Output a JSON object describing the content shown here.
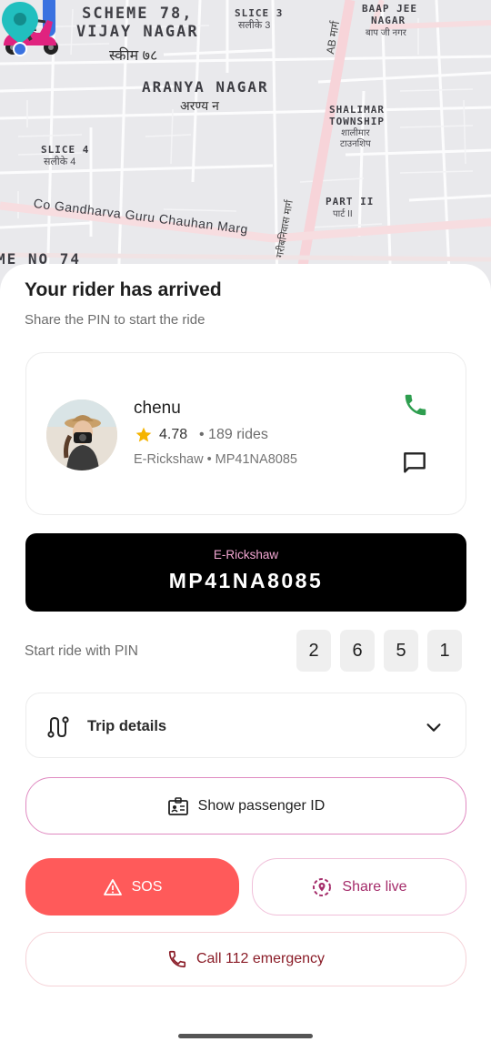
{
  "map": {
    "labels": {
      "scheme78": "SCHEME 78,\nVIJAY NAGAR",
      "scheme78_hi": "स्कीम ७८",
      "slice3": "SLICE 3",
      "slice3_hi": "सलीके 3",
      "baap_jee": "BAAP JEE",
      "baap_jee2": "NAGAR",
      "baap_jee_hi": "बाप जी नगर",
      "aranya": "ARANYA NAGAR",
      "aranya_hi": "अरण्य न",
      "shalimar": "SHALIMAR\nTOWNSHIP",
      "shalimar_hi": "शालीमार\nटाउनशिप",
      "slice4": "SLICE 4",
      "slice4_hi": "सलीके 4",
      "part2": "PART II",
      "part2_hi": "पार्ट II",
      "road": "Co Gandharva Guru Chauhan Marg",
      "ab_road": "AB मार्ग",
      "gari_road": "गरीबनिवास मार्ग",
      "scheme_bottom": "ME NO 74"
    }
  },
  "sheet": {
    "title": "Your rider has arrived",
    "subtitle": "Share the PIN to start the ride"
  },
  "driver": {
    "name": "chenu",
    "rating": "4.78",
    "rides": "• 189 rides",
    "vehicle_line": "E-Rickshaw • MP41NA8085"
  },
  "plate": {
    "type": "E-Rickshaw",
    "number": "MP41NA8085"
  },
  "pin": {
    "label": "Start ride with PIN",
    "digits": [
      "2",
      "6",
      "5",
      "1"
    ]
  },
  "trip": {
    "label": "Trip details"
  },
  "buttons": {
    "show_id": "Show passenger ID",
    "sos": "SOS",
    "share_live": "Share live",
    "call_emergency": "Call 112 emergency"
  },
  "colors": {
    "sos_bg": "#ff5a5a",
    "share_text": "#a52d6b",
    "call_text": "#8a1c27",
    "phone_green": "#2e9e4f",
    "star": "#f5b400",
    "plate_type": "#f2a6d2"
  },
  "icons": {
    "pin": "map-pin-icon",
    "rider": "scooter-rider-icon",
    "star": "star-icon",
    "phone": "phone-icon",
    "chat": "chat-bubble-icon",
    "route": "route-icon",
    "chevron": "chevron-down-icon",
    "id": "id-card-icon",
    "warning": "warning-triangle-icon",
    "share": "share-location-icon",
    "call": "phone-outline-icon"
  }
}
